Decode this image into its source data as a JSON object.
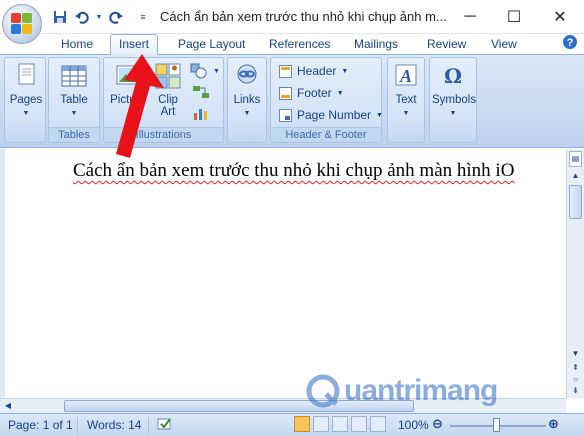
{
  "window": {
    "title": "Cách ẩn bản xem trước thu nhỏ khi chụp ảnh m...",
    "minimize": "─",
    "maximize": "☐",
    "close": "✕"
  },
  "tabs": [
    {
      "label": "Home"
    },
    {
      "label": "Insert"
    },
    {
      "label": "Page Layout"
    },
    {
      "label": "References"
    },
    {
      "label": "Mailings"
    },
    {
      "label": "Review"
    },
    {
      "label": "View"
    }
  ],
  "ribbon": {
    "pages": {
      "label": "Pages"
    },
    "tables": {
      "button": "Table",
      "group": "Tables"
    },
    "illustrations": {
      "picture": "Picture",
      "clipart_1": "Clip",
      "clipart_2": "Art",
      "group": "Illustrations"
    },
    "links": {
      "label": "Links"
    },
    "header_footer": {
      "header": "Header",
      "footer": "Footer",
      "page_number": "Page Number",
      "group": "Header & Footer"
    },
    "text": {
      "label": "Text"
    },
    "symbols": {
      "label": "Symbols"
    }
  },
  "document": {
    "text": "Cách ẩn bản xem trước thu nhỏ khi chụp ảnh màn hình iO"
  },
  "status": {
    "page": "Page: 1 of 1",
    "words": "Words: 14",
    "zoom": "100%"
  },
  "watermark": {
    "text": "uantrimang"
  },
  "colors": {
    "ribbon_bg": "#c8dbf2",
    "accent_text": "#15428b",
    "arrow": "#e8121b"
  }
}
